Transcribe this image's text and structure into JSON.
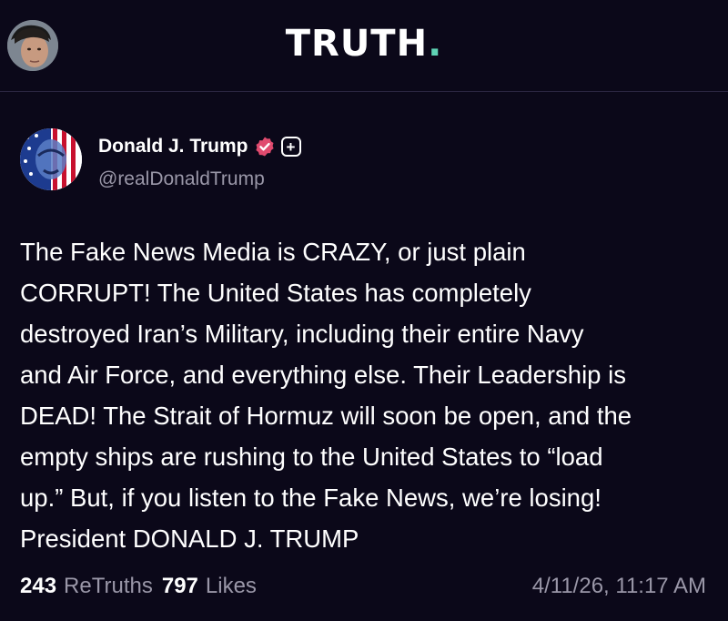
{
  "header": {
    "logo_text": "TRUTH",
    "logo_dot": ".",
    "accent_color": "#5fd3b5",
    "avatar_icon": "user-avatar"
  },
  "post": {
    "author": {
      "name": "Donald J. Trump",
      "handle": "@realDonaldTrump",
      "verified_icon": "verified-badge-icon",
      "verified_color": "#e04a6e",
      "plus_icon": "plus-badge-icon",
      "avatar_icon": "flag-portrait-avatar"
    },
    "body": "The Fake News Media is CRAZY, or just plain\nCORRUPT! The United States has completely\ndestroyed Iran’s Military, including their entire Navy\nand Air Force, and everything else. Their Leadership is\nDEAD! The Strait of Hormuz will soon be open, and the\nempty ships are rushing to the United States to “load\nup.” But, if you listen to the Fake News, we’re losing!\nPresident DONALD J. TRUMP",
    "stats": {
      "retruths_count": "243",
      "retruths_label": "ReTruths",
      "likes_count": "797",
      "likes_label": "Likes"
    },
    "timestamp": "4/11/26, 11:17 AM"
  }
}
